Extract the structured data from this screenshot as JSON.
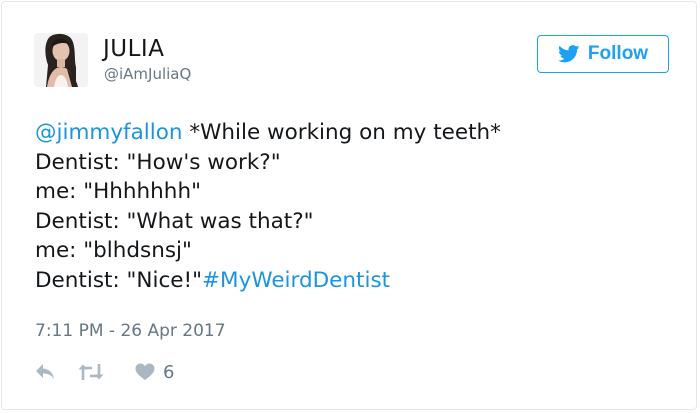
{
  "tweet": {
    "author": {
      "name": "JULIA",
      "handle": "@iAmJuliaQ",
      "avatar": "avatar-photo"
    },
    "follow_button": {
      "icon": "twitter-bird-icon",
      "label": "Follow"
    },
    "text": {
      "mention": "@jimmyfallon",
      "line1_rest": " *While working on my teeth*",
      "line2": "Dentist: \"How's work?\"",
      "line3": "me: \"Hhhhhhh\"",
      "line4": "Dentist: \"What was that?\"",
      "line5": "me: \"blhdsnsj\"",
      "line6_prefix": "Dentist: \"Nice!\"",
      "hashtag": "#MyWeirdDentist"
    },
    "timestamp": "7:11 PM - 26 Apr 2017",
    "actions": {
      "reply_icon": "reply-icon",
      "retweet_icon": "retweet-icon",
      "like_icon": "heart-icon",
      "like_count": "6"
    },
    "colors": {
      "accent": "#1da1f2",
      "link": "#1b95e0",
      "muted": "#657786",
      "icon": "#aab8c2",
      "border": "#e1e8ed"
    }
  }
}
